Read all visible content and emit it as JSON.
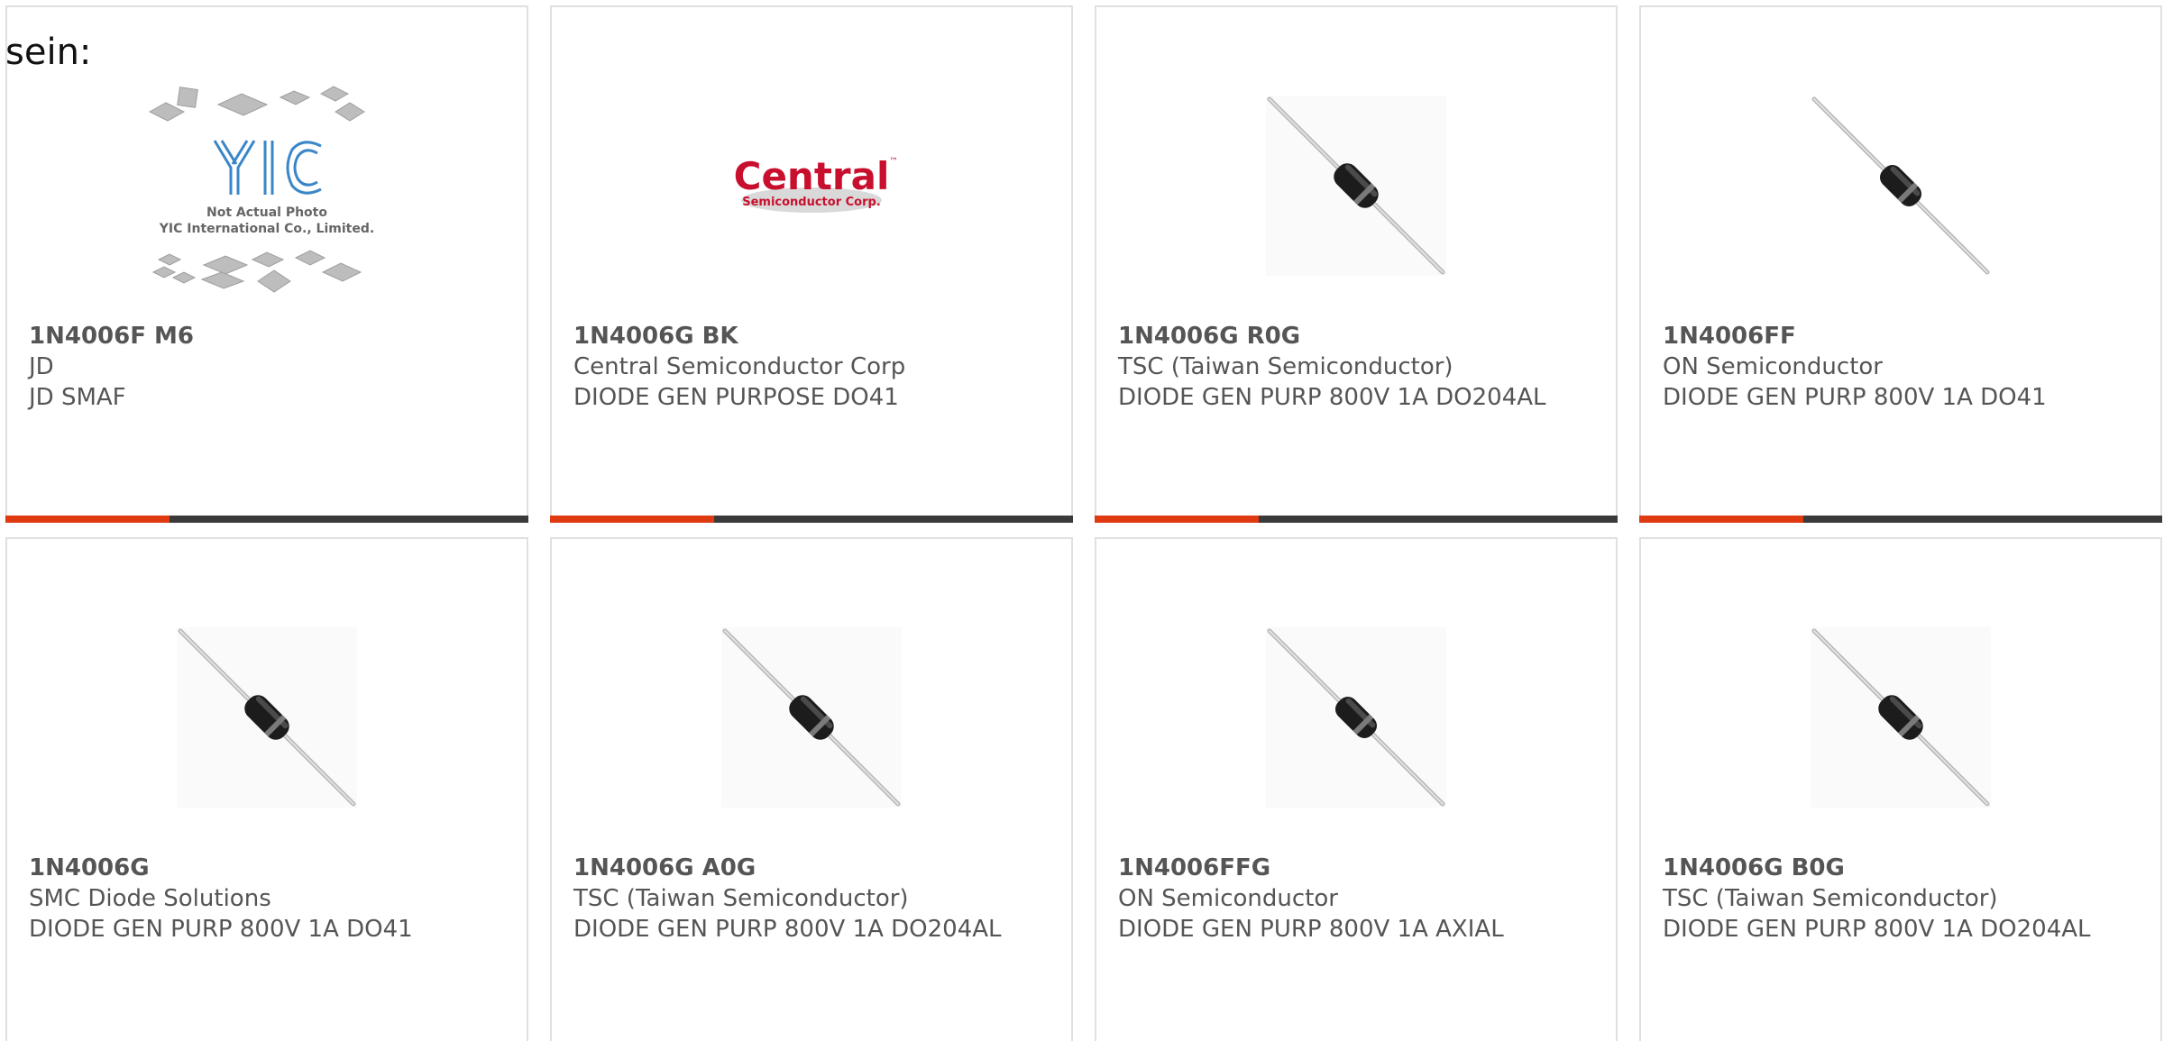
{
  "intro_text": "sein:",
  "placeholder": {
    "logo_text": "YIC",
    "line1": "Not Actual Photo",
    "line2": "YIC International Co., Limited."
  },
  "central_logo": {
    "word": "Central",
    "sub": "Semiconductor Corp.",
    "tm": "™"
  },
  "colors": {
    "accent": "#e03a12",
    "bar_dark": "#3a3a3a",
    "text": "#555555",
    "border": "#e0e0e0"
  },
  "products": [
    {
      "part": "1N4006F M6",
      "manufacturer": "JD",
      "description": "JD SMAF",
      "image": "placeholder-yic"
    },
    {
      "part": "1N4006G BK",
      "manufacturer": "Central Semiconductor Corp",
      "description": "DIODE GEN PURPOSE DO41",
      "image": "central-logo"
    },
    {
      "part": "1N4006G R0G",
      "manufacturer": "TSC (Taiwan Semiconductor)",
      "description": "DIODE GEN PURP 800V 1A DO204AL",
      "image": "diode-axial"
    },
    {
      "part": "1N4006FF",
      "manufacturer": "ON Semiconductor",
      "description": "DIODE GEN PURP 800V 1A DO41",
      "image": "diode-axial"
    },
    {
      "part": "1N4006G",
      "manufacturer": "SMC Diode Solutions",
      "description": "DIODE GEN PURP 800V 1A DO41",
      "image": "diode-axial"
    },
    {
      "part": "1N4006G A0G",
      "manufacturer": "TSC (Taiwan Semiconductor)",
      "description": "DIODE GEN PURP 800V 1A DO204AL",
      "image": "diode-axial"
    },
    {
      "part": "1N4006FFG",
      "manufacturer": "ON Semiconductor",
      "description": "DIODE GEN PURP 800V 1A AXIAL",
      "image": "diode-axial"
    },
    {
      "part": "1N4006G B0G",
      "manufacturer": "TSC (Taiwan Semiconductor)",
      "description": "DIODE GEN PURP 800V 1A DO204AL",
      "image": "diode-axial"
    }
  ]
}
